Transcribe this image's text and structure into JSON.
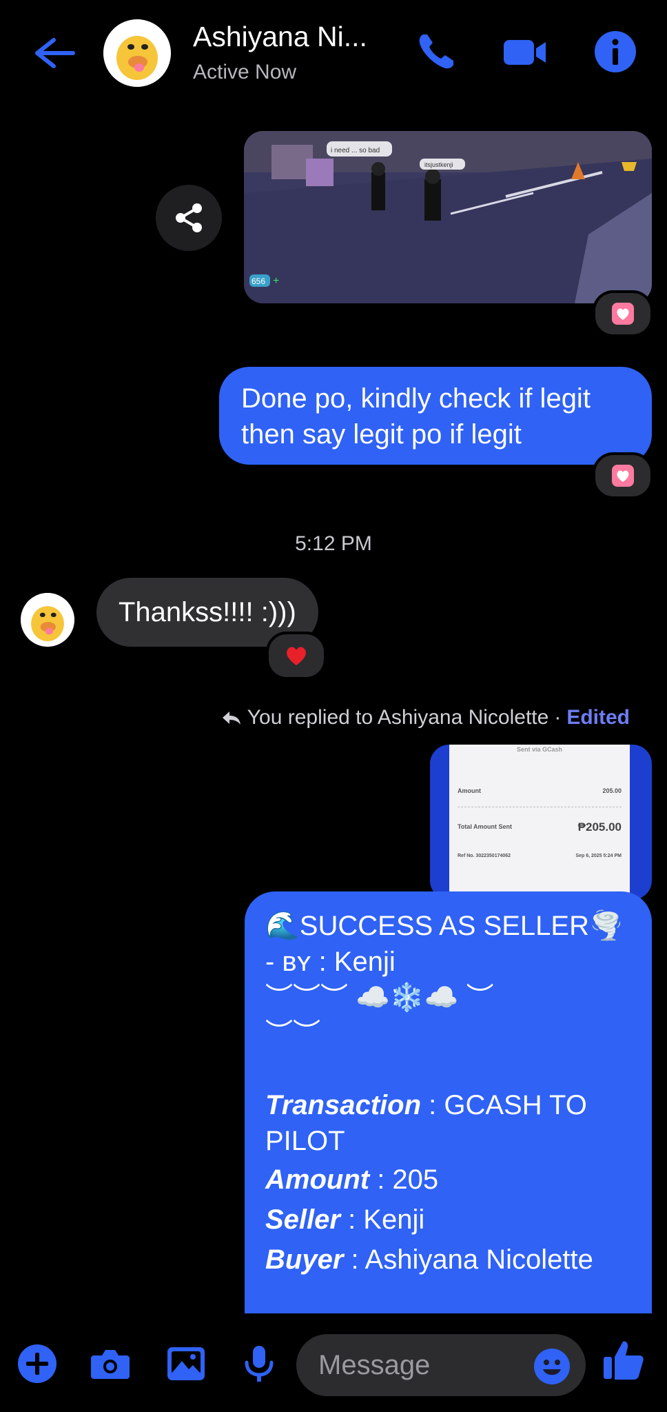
{
  "header": {
    "contact_name": "Ashiyana Ni...",
    "status": "Active Now"
  },
  "messages": {
    "msg1_text_line1": "Done po, kindly check if legit",
    "msg1_text_line2": "then say legit po if legit",
    "timestamp": "5:12 PM",
    "incoming_text": "Thankss!!!! :)))",
    "reply_context": "You replied to Ashiyana Nicolette",
    "reply_separator": "·",
    "edited_label": "Edited"
  },
  "receipt": {
    "title": "Sent via GCash",
    "amount_label": "Amount",
    "amount_value": "205.00",
    "total_label": "Total Amount Sent",
    "total_value": "₱205.00",
    "ref_label": "Ref No. 3022350174062",
    "date_value": "Sep 6, 2025 5:24 PM"
  },
  "success_message": {
    "title": "🌊SUCCESS AS SELLER🌪️",
    "by_line": "- ʙʏ : Kenji",
    "deco1": "︶︶︶ ☁️❄️☁️ ︶",
    "deco2": "︶︶",
    "transaction_label": "Transaction",
    "transaction_value": " : GCASH TO",
    "transaction_value2": "PILOT",
    "amount_label": "Amount",
    "amount_value": " :  205",
    "seller_label": "Seller",
    "seller_value": " : Kenji",
    "buyer_label": "Buyer",
    "buyer_value": " : Ashiyana Nicolette"
  },
  "game_screenshot": {
    "player_tag": "itsjustkenji",
    "chat_bubble": "i need ... so bad",
    "currency": "656"
  },
  "composer": {
    "placeholder": "Message"
  },
  "colors": {
    "accent": "#2f62f5",
    "incoming_bubble": "#303033",
    "background": "#000000",
    "reaction_heart": "#ff7aa0",
    "edited": "#6e7df5"
  },
  "icons": [
    "back-arrow-icon",
    "phone-icon",
    "video-camera-icon",
    "info-icon",
    "share-icon",
    "heart-reaction-icon",
    "red-heart-reaction-icon",
    "reply-arrow-icon",
    "plus-icon",
    "camera-icon",
    "gallery-icon",
    "microphone-icon",
    "emoji-icon",
    "thumbs-up-icon"
  ]
}
